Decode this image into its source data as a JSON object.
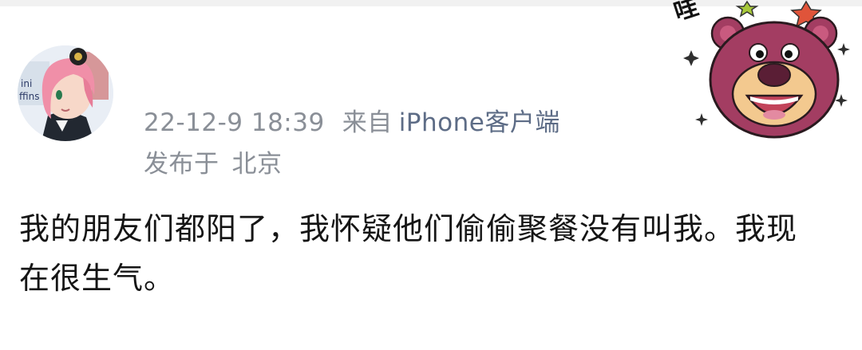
{
  "post": {
    "timestamp": "22-12-9 18:39",
    "source_prefix": "来自",
    "source_client": "iPhone客户端",
    "location_prefix": "发布于",
    "location": "北京",
    "content": "我的朋友们都阳了，我怀疑他们偷偷聚餐没有叫我。我现在很生气。"
  },
  "sticker": {
    "exclamation": "哇",
    "icon": "strawberry-bear-icon"
  },
  "avatar": {
    "icon": "pink-hair-anime-girl-avatar",
    "visible_text": [
      "ini",
      "ffins"
    ]
  },
  "colors": {
    "meta_text": "#8a8f97",
    "client_text": "#5d6c86",
    "body_text": "#151515",
    "bear_face": "#a33d62",
    "bear_muzzle": "#f3c98f"
  }
}
